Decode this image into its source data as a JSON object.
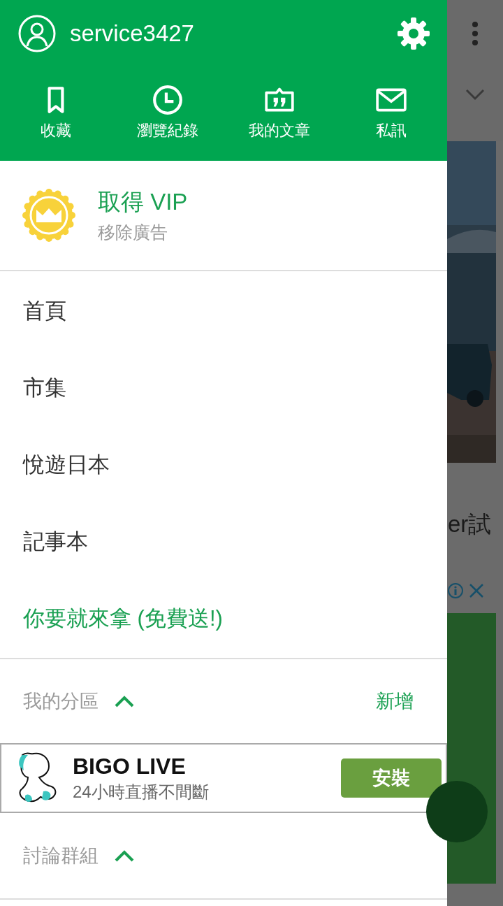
{
  "drawer": {
    "user": {
      "name": "service3427"
    },
    "shortcuts": [
      {
        "kind": "bookmark",
        "label": "收藏"
      },
      {
        "kind": "history",
        "label": "瀏覽紀錄"
      },
      {
        "kind": "article",
        "label": "我的文章"
      },
      {
        "kind": "mail",
        "label": "私訊"
      }
    ],
    "vip": {
      "title": "取得 VIP",
      "subtitle": "移除廣告"
    },
    "menu": [
      {
        "label": "首頁",
        "kind": "normal"
      },
      {
        "label": "市集",
        "kind": "normal"
      },
      {
        "label": "悅遊日本",
        "kind": "normal"
      },
      {
        "label": "記事本",
        "kind": "normal"
      },
      {
        "label": "你要就來拿 (免費送!)",
        "kind": "promo"
      }
    ],
    "my_sections": {
      "title": "我的分區",
      "expanded": true,
      "action": "新增"
    },
    "ad": {
      "title": "BIGO LIVE",
      "subtitle": "24小時直播不間斷",
      "button": "安裝"
    },
    "groups": {
      "title": "討論群組",
      "expanded": true
    }
  },
  "background": {
    "text": "er試"
  }
}
